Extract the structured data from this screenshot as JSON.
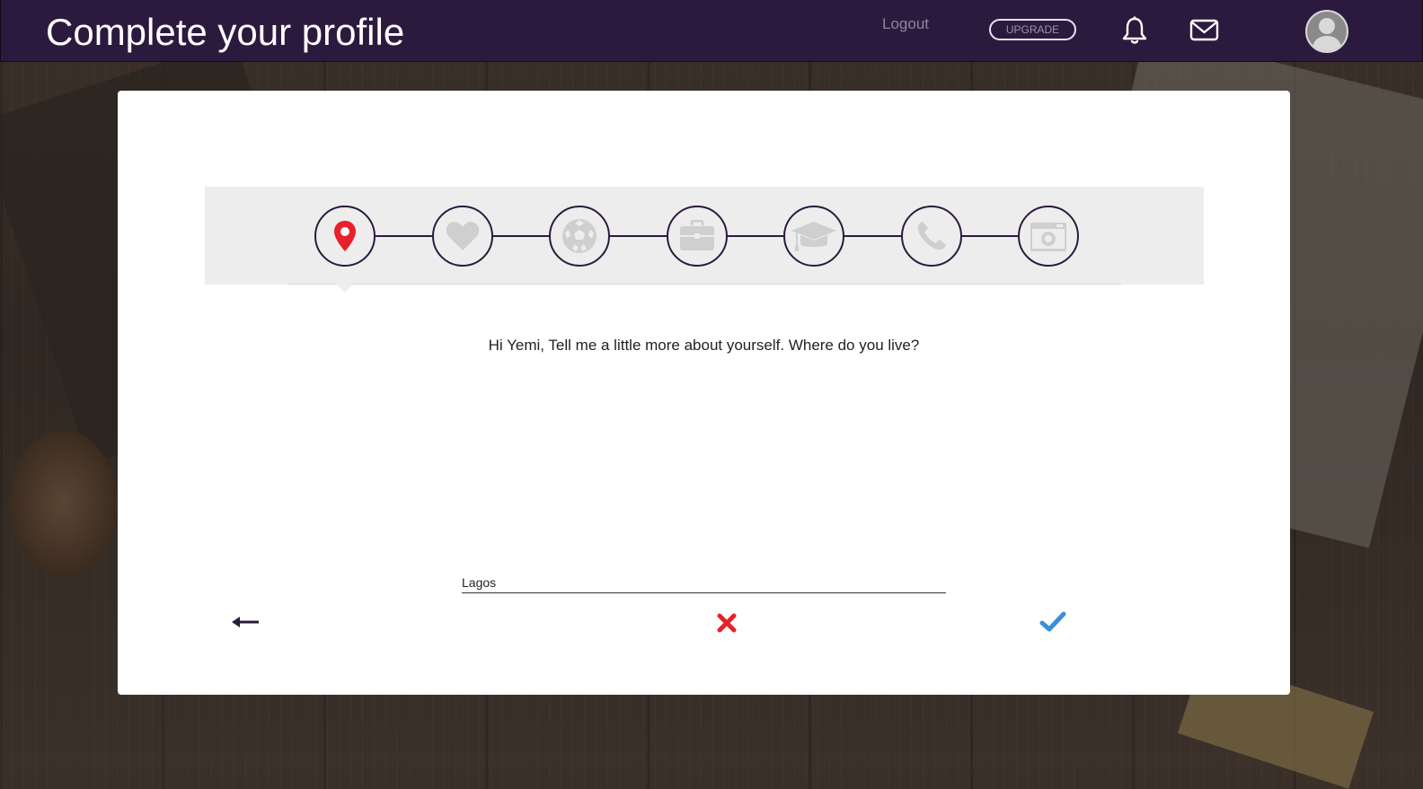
{
  "header": {
    "title": "Complete your profile",
    "logout_label": "Logout",
    "upgrade_label": "UPGRADE",
    "icons": [
      "bell-icon",
      "mail-icon",
      "user-avatar"
    ]
  },
  "stepper": {
    "steps": [
      {
        "name": "location",
        "icon": "map-pin-icon",
        "active": true
      },
      {
        "name": "interests",
        "icon": "heart-icon",
        "active": false
      },
      {
        "name": "sports",
        "icon": "soccer-ball-icon",
        "active": false
      },
      {
        "name": "work",
        "icon": "briefcase-icon",
        "active": false
      },
      {
        "name": "education",
        "icon": "graduation-cap-icon",
        "active": false
      },
      {
        "name": "contact",
        "icon": "phone-icon",
        "active": false
      },
      {
        "name": "photo",
        "icon": "camera-icon",
        "active": false
      }
    ]
  },
  "main": {
    "question": "Hi Yemi, Tell me a little more about yourself. Where do you live?",
    "answer_value": "Lagos"
  },
  "actions": {
    "back_icon": "arrow-left-icon",
    "cancel_icon": "close-icon",
    "confirm_icon": "checkmark-icon"
  },
  "colors": {
    "header_bg": "#2c1a3e",
    "active_step": "#e8202a",
    "inactive_icon": "#cfcfcf",
    "cancel": "#e8202a",
    "confirm": "#3a8fd9"
  }
}
